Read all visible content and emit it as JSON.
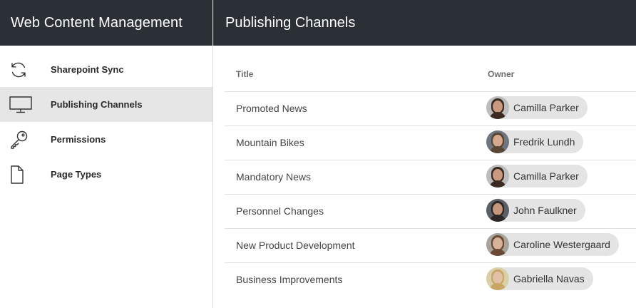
{
  "app": {
    "title": "Web Content Management"
  },
  "sidebar": {
    "items": [
      {
        "label": "Sharepoint Sync",
        "icon": "sync-icon",
        "active": false
      },
      {
        "label": "Publishing Channels",
        "icon": "monitor-icon",
        "active": true
      },
      {
        "label": "Permissions",
        "icon": "key-icon",
        "active": false
      },
      {
        "label": "Page Types",
        "icon": "document-icon",
        "active": false
      }
    ]
  },
  "main": {
    "title": "Publishing Channels",
    "table": {
      "columns": [
        "Title",
        "Owner"
      ],
      "rows": [
        {
          "title": "Promoted News",
          "owner": "Camilla Parker",
          "avatar": {
            "hair": "#3a2a22",
            "skin": "#c99a80",
            "bg": "#bdbdbd"
          }
        },
        {
          "title": "Mountain Bikes",
          "owner": "Fredrik Lundh",
          "avatar": {
            "hair": "#5a4634",
            "skin": "#d6a98e",
            "bg": "#6f7680"
          }
        },
        {
          "title": "Mandatory News",
          "owner": "Camilla Parker",
          "avatar": {
            "hair": "#3a2a22",
            "skin": "#c99a80",
            "bg": "#bdbdbd"
          }
        },
        {
          "title": "Personnel Changes",
          "owner": "John Faulkner",
          "avatar": {
            "hair": "#2e2622",
            "skin": "#c7967c",
            "bg": "#5b5f66"
          }
        },
        {
          "title": "New Product Development",
          "owner": "Caroline Westergaard",
          "avatar": {
            "hair": "#6b4a35",
            "skin": "#d8b39b",
            "bg": "#a8a39b"
          }
        },
        {
          "title": "Business Improvements",
          "owner": "Gabriella Navas",
          "avatar": {
            "hair": "#c9a566",
            "skin": "#e2c2a6",
            "bg": "#d9cfa8"
          }
        }
      ]
    }
  }
}
